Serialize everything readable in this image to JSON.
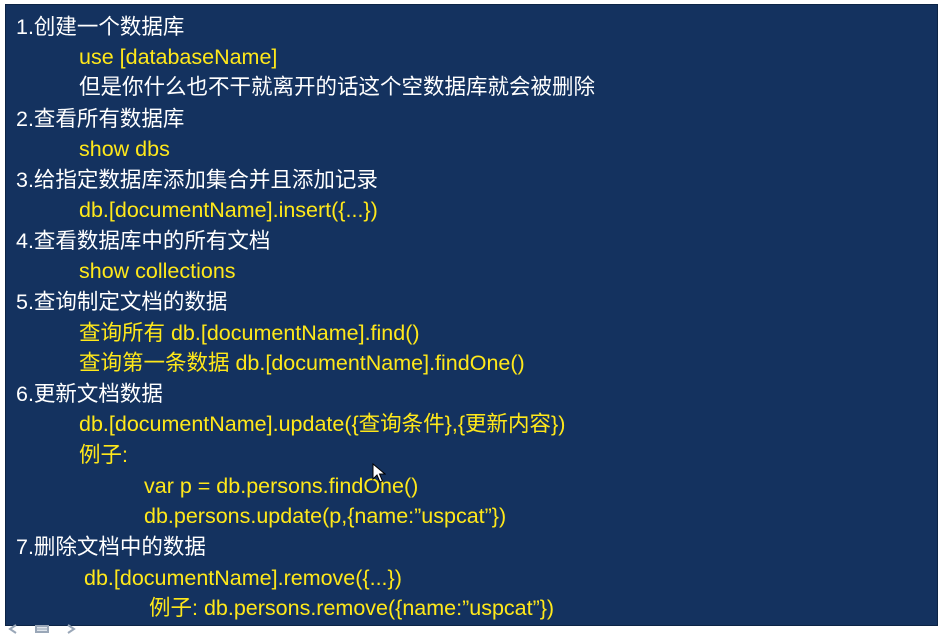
{
  "slide": {
    "lines": [
      {
        "id": "h1",
        "text": "1.创建一个数据库",
        "color": "white"
      },
      {
        "id": "h1-a",
        "text": "use [databaseName]",
        "color": "yellow"
      },
      {
        "id": "h1-b",
        "text": "但是你什么也不干就离开的话这个空数据库就会被删除",
        "color": "white"
      },
      {
        "id": "h2",
        "text": "2.查看所有数据库",
        "color": "white"
      },
      {
        "id": "h2-a",
        "text": "show dbs",
        "color": "yellow"
      },
      {
        "id": "h3",
        "text": "3.给指定数据库添加集合并且添加记录",
        "color": "white"
      },
      {
        "id": "h3-a",
        "text": "db.[documentName].insert({...})",
        "color": "yellow"
      },
      {
        "id": "h4",
        "text": "4.查看数据库中的所有文档",
        "color": "white"
      },
      {
        "id": "h4-a",
        "text": "show collections",
        "color": "yellow"
      },
      {
        "id": "h5",
        "text": "5.查询制定文档的数据",
        "color": "white"
      },
      {
        "id": "h5-a",
        "text": "查询所有 db.[documentName].find()",
        "color": "yellow"
      },
      {
        "id": "h5-b",
        "text": "查询第一条数据  db.[documentName].findOne()",
        "color": "yellow"
      },
      {
        "id": "h6",
        "text": "6.更新文档数据",
        "color": "white"
      },
      {
        "id": "h6-a",
        "text": "db.[documentName].update({查询条件},{更新内容})",
        "color": "yellow"
      },
      {
        "id": "h6-b",
        "text": "例子:",
        "color": "yellow"
      },
      {
        "id": "h6-c",
        "text": "var  p = db.persons.findOne()",
        "color": "yellow"
      },
      {
        "id": "h6-d",
        "text": "db.persons.update(p,{name:”uspcat”})",
        "color": "yellow"
      },
      {
        "id": "h7",
        "text": "7.删除文档中的数据",
        "color": "white"
      },
      {
        "id": "h7-a",
        "text": "db.[documentName].remove({...})",
        "color": "yellow"
      },
      {
        "id": "h7-b",
        "text": "例子: db.persons.remove({name:”uspcat”})",
        "color": "yellow"
      }
    ]
  },
  "colors": {
    "background": "#14325f",
    "white_text": "#ffffff",
    "yellow_text": "#ffe81a"
  },
  "icons": [
    "back-icon",
    "slide-menu-icon",
    "forward-icon",
    "mouse-cursor-icon"
  ]
}
